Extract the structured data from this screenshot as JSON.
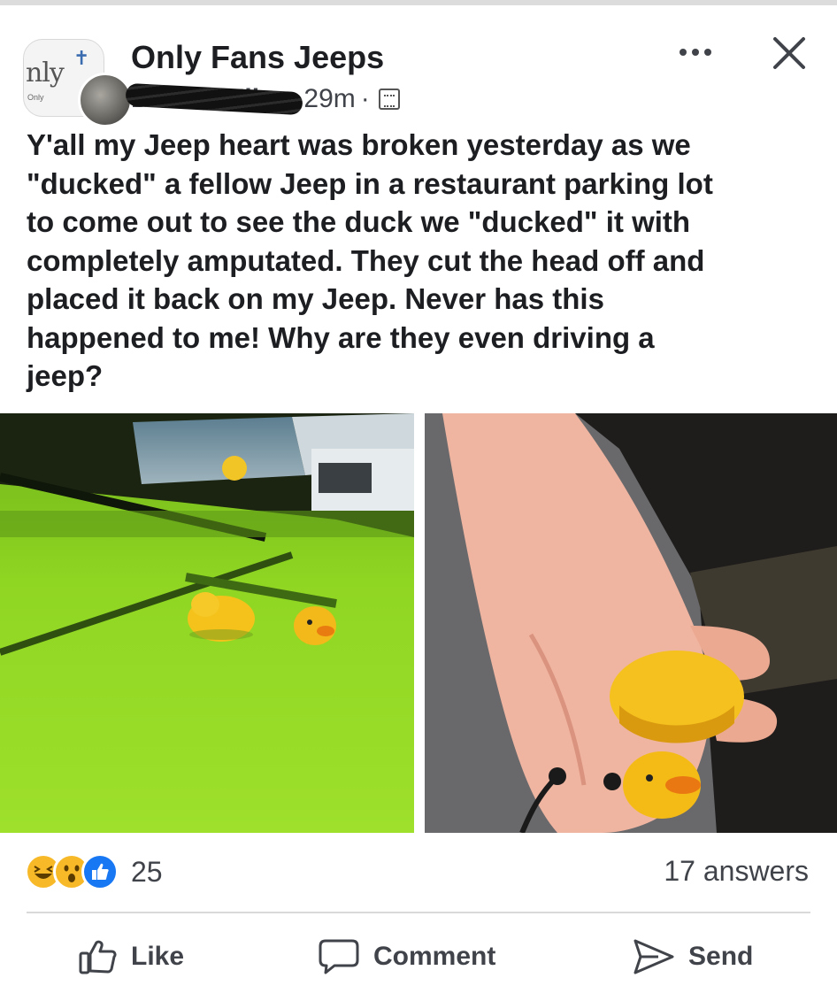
{
  "post": {
    "group_name": "Only Fans Jeeps",
    "author": "Debbie Eller",
    "time": "29m",
    "separator": "·",
    "text": "Y'all my Jeep heart was broken yesterday as we\n\"ducked\" a fellow Jeep in a restaurant parking lot\nto come out to see the duck we \"ducked\" it with\ncompletely amputated. They cut the head off and\nplaced it back on my Jeep. Never has this\nhappened to me! Why are they even driving a\njeep?",
    "group_avatar_text": "nly",
    "group_avatar_small": "Only"
  },
  "photos": [
    {
      "name": "duck-on-jeep-hood"
    },
    {
      "name": "duck-in-hand"
    }
  ],
  "engagement": {
    "reaction_icons": [
      "haha-icon",
      "wow-icon",
      "like-icon"
    ],
    "reaction_count": "25",
    "answers": "17 answers"
  },
  "actions": {
    "like": "Like",
    "comment": "Comment",
    "send": "Send"
  },
  "colors": {
    "text": "#1c1e21",
    "secondary": "#404349",
    "like_blue": "#1877f2",
    "reaction_yellow": "#f7b928",
    "jeep_green": "#8fd622"
  }
}
